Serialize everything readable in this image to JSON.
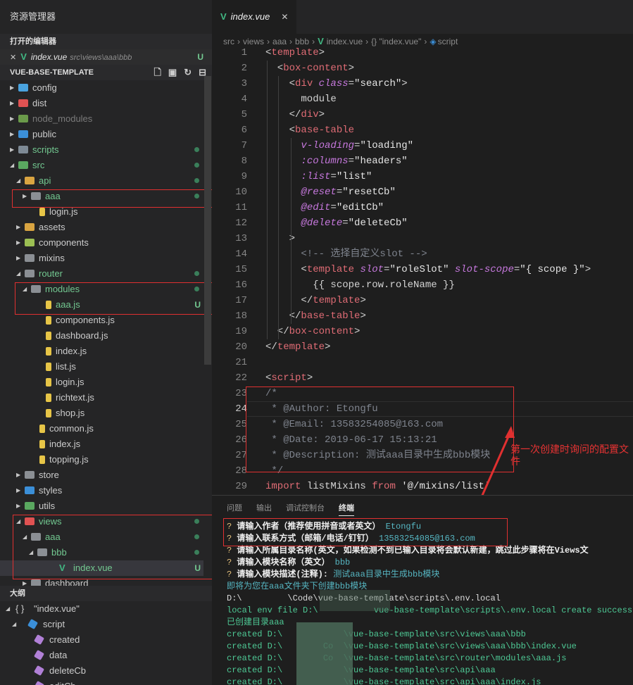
{
  "sidebar": {
    "title": "资源管理器",
    "open_editors": {
      "header": "打开的编辑器",
      "items": [
        {
          "close": "✕",
          "name": "index.vue",
          "path": "src\\views\\aaa\\bbb",
          "status": "U"
        }
      ]
    },
    "project": {
      "header": "VUE-BASE-TEMPLATE",
      "tools": [
        "new-file-icon",
        "new-folder-icon",
        "refresh-icon",
        "collapse-all-icon"
      ]
    },
    "tree": [
      {
        "label": "config",
        "depth": 0,
        "expanded": false,
        "icon": "#4aa3df"
      },
      {
        "label": "dist",
        "depth": 0,
        "expanded": false,
        "icon": "#e05252"
      },
      {
        "label": "node_modules",
        "depth": 0,
        "expanded": false,
        "icon": "#6a9a4a",
        "dim": true
      },
      {
        "label": "public",
        "depth": 0,
        "expanded": false,
        "icon": "#3b8fd8"
      },
      {
        "label": "scripts",
        "depth": 0,
        "expanded": false,
        "icon": "#7e8a95",
        "dot": true
      },
      {
        "label": "src",
        "depth": 0,
        "expanded": true,
        "icon": "#5aa860",
        "dot": true
      },
      {
        "label": "api",
        "depth": 1,
        "expanded": true,
        "icon": "#d9a441",
        "dot": true
      },
      {
        "label": "aaa",
        "depth": 2,
        "expanded": false,
        "icon": "#8b8f94",
        "dot": true
      },
      {
        "label": "login.js",
        "depth": 2,
        "file": true,
        "icon": "#e7c547"
      },
      {
        "label": "assets",
        "depth": 1,
        "expanded": false,
        "icon": "#d9a441"
      },
      {
        "label": "components",
        "depth": 1,
        "expanded": false,
        "icon": "#9bbf53"
      },
      {
        "label": "mixins",
        "depth": 1,
        "expanded": false,
        "icon": "#8b8f94"
      },
      {
        "label": "router",
        "depth": 1,
        "expanded": true,
        "icon": "#8b8f94",
        "dot": true
      },
      {
        "label": "modules",
        "depth": 2,
        "expanded": true,
        "icon": "#8b8f94",
        "dot": true
      },
      {
        "label": "aaa.js",
        "depth": 3,
        "file": true,
        "icon": "#e7c547",
        "status": "U"
      },
      {
        "label": "components.js",
        "depth": 3,
        "file": true,
        "icon": "#e7c547"
      },
      {
        "label": "dashboard.js",
        "depth": 3,
        "file": true,
        "icon": "#e7c547"
      },
      {
        "label": "index.js",
        "depth": 3,
        "file": true,
        "icon": "#e7c547"
      },
      {
        "label": "list.js",
        "depth": 3,
        "file": true,
        "icon": "#e7c547"
      },
      {
        "label": "login.js",
        "depth": 3,
        "file": true,
        "icon": "#e7c547"
      },
      {
        "label": "richtext.js",
        "depth": 3,
        "file": true,
        "icon": "#e7c547"
      },
      {
        "label": "shop.js",
        "depth": 3,
        "file": true,
        "icon": "#e7c547"
      },
      {
        "label": "common.js",
        "depth": 2,
        "file": true,
        "icon": "#e7c547"
      },
      {
        "label": "index.js",
        "depth": 2,
        "file": true,
        "icon": "#e7c547"
      },
      {
        "label": "topping.js",
        "depth": 2,
        "file": true,
        "icon": "#e7c547"
      },
      {
        "label": "store",
        "depth": 1,
        "expanded": false,
        "icon": "#8b8f94"
      },
      {
        "label": "styles",
        "depth": 1,
        "expanded": false,
        "icon": "#3b8fd8"
      },
      {
        "label": "utils",
        "depth": 1,
        "expanded": false,
        "icon": "#5aa860"
      },
      {
        "label": "views",
        "depth": 1,
        "expanded": true,
        "icon": "#e05252",
        "dot": true
      },
      {
        "label": "aaa",
        "depth": 2,
        "expanded": true,
        "icon": "#8b8f94",
        "dot": true
      },
      {
        "label": "bbb",
        "depth": 3,
        "expanded": true,
        "icon": "#8b8f94",
        "dot": true
      },
      {
        "label": "index.vue",
        "depth": 4,
        "file": true,
        "vue": true,
        "status": "U",
        "selected": true
      },
      {
        "label": "dashboard",
        "depth": 2,
        "expanded": false,
        "icon": "#8b8f94"
      }
    ],
    "outline": {
      "header": "大纲",
      "items": [
        {
          "label": "\"index.vue\"",
          "prefix": "{ }",
          "depth": 0,
          "expanded": true
        },
        {
          "label": "script",
          "depth": 1,
          "expanded": true,
          "icon": "#3b8fd8"
        },
        {
          "label": "created",
          "depth": 2,
          "icon": "#b180d7"
        },
        {
          "label": "data",
          "depth": 2,
          "icon": "#b180d7"
        },
        {
          "label": "deleteCb",
          "depth": 2,
          "icon": "#b180d7"
        },
        {
          "label": "editCb",
          "depth": 2,
          "icon": "#b180d7"
        }
      ]
    }
  },
  "editor": {
    "tab": {
      "name": "index.vue",
      "close": "✕"
    },
    "breadcrumbs": [
      "src",
      "views",
      "aaa",
      "bbb",
      "index.vue",
      "{} \"index.vue\"",
      "script"
    ],
    "code": [
      [
        {
          "t": "<",
          "c": "br"
        },
        {
          "t": "template",
          "c": "tg"
        },
        {
          "t": ">",
          "c": "br"
        }
      ],
      [
        {
          "t": "  <",
          "c": "br"
        },
        {
          "t": "box-content",
          "c": "tg"
        },
        {
          "t": ">",
          "c": "br"
        }
      ],
      [
        {
          "t": "    <",
          "c": "br"
        },
        {
          "t": "div ",
          "c": "tg"
        },
        {
          "t": "class",
          "c": "at"
        },
        {
          "t": "=",
          "c": "br"
        },
        {
          "t": "\"search\"",
          "c": "st"
        },
        {
          "t": ">",
          "c": "br"
        }
      ],
      [
        {
          "t": "      module",
          "c": "br"
        }
      ],
      [
        {
          "t": "    </",
          "c": "br"
        },
        {
          "t": "div",
          "c": "tg"
        },
        {
          "t": ">",
          "c": "br"
        }
      ],
      [
        {
          "t": "    <",
          "c": "br"
        },
        {
          "t": "base-table",
          "c": "tg"
        }
      ],
      [
        {
          "t": "      ",
          "c": "br"
        },
        {
          "t": "v-loading",
          "c": "at"
        },
        {
          "t": "=",
          "c": "br"
        },
        {
          "t": "\"loading\"",
          "c": "st"
        }
      ],
      [
        {
          "t": "      ",
          "c": "br"
        },
        {
          "t": ":columns",
          "c": "at"
        },
        {
          "t": "=",
          "c": "br"
        },
        {
          "t": "\"headers\"",
          "c": "st"
        }
      ],
      [
        {
          "t": "      ",
          "c": "br"
        },
        {
          "t": ":list",
          "c": "at"
        },
        {
          "t": "=",
          "c": "br"
        },
        {
          "t": "\"list\"",
          "c": "st"
        }
      ],
      [
        {
          "t": "      ",
          "c": "br"
        },
        {
          "t": "@reset",
          "c": "at"
        },
        {
          "t": "=",
          "c": "br"
        },
        {
          "t": "\"resetCb\"",
          "c": "st"
        }
      ],
      [
        {
          "t": "      ",
          "c": "br"
        },
        {
          "t": "@edit",
          "c": "at"
        },
        {
          "t": "=",
          "c": "br"
        },
        {
          "t": "\"editCb\"",
          "c": "st"
        }
      ],
      [
        {
          "t": "      ",
          "c": "br"
        },
        {
          "t": "@delete",
          "c": "at"
        },
        {
          "t": "=",
          "c": "br"
        },
        {
          "t": "\"deleteCb\"",
          "c": "st"
        }
      ],
      [
        {
          "t": "    >",
          "c": "br"
        }
      ],
      [
        {
          "t": "      <!-- 选择自定义slot -->",
          "c": "cm"
        }
      ],
      [
        {
          "t": "      <",
          "c": "br"
        },
        {
          "t": "template ",
          "c": "tg"
        },
        {
          "t": "slot",
          "c": "at"
        },
        {
          "t": "=",
          "c": "br"
        },
        {
          "t": "\"roleSlot\" ",
          "c": "st"
        },
        {
          "t": "slot-scope",
          "c": "at"
        },
        {
          "t": "=",
          "c": "br"
        },
        {
          "t": "\"{ scope }\"",
          "c": "st"
        },
        {
          "t": ">",
          "c": "br"
        }
      ],
      [
        {
          "t": "        {{ scope.row.roleName }}",
          "c": "br"
        }
      ],
      [
        {
          "t": "      </",
          "c": "br"
        },
        {
          "t": "template",
          "c": "tg"
        },
        {
          "t": ">",
          "c": "br"
        }
      ],
      [
        {
          "t": "    </",
          "c": "br"
        },
        {
          "t": "base-table",
          "c": "tg"
        },
        {
          "t": ">",
          "c": "br"
        }
      ],
      [
        {
          "t": "  </",
          "c": "br"
        },
        {
          "t": "box-content",
          "c": "tg"
        },
        {
          "t": ">",
          "c": "br"
        }
      ],
      [
        {
          "t": "</",
          "c": "br"
        },
        {
          "t": "template",
          "c": "tg"
        },
        {
          "t": ">",
          "c": "br"
        }
      ],
      [
        {
          "t": "",
          "c": "br"
        }
      ],
      [
        {
          "t": "<",
          "c": "br"
        },
        {
          "t": "script",
          "c": "tg"
        },
        {
          "t": ">",
          "c": "br"
        }
      ],
      [
        {
          "t": "/*",
          "c": "cm"
        }
      ],
      [
        {
          "t": " * @Author: Etongfu",
          "c": "cm"
        }
      ],
      [
        {
          "t": " * @Email: 13583254085@163.com",
          "c": "cm"
        }
      ],
      [
        {
          "t": " * @Date: 2019-06-17 15:13:21",
          "c": "cm"
        }
      ],
      [
        {
          "t": " * @Description: 测试aaa目录中生成bbb模块",
          "c": "cm"
        }
      ],
      [
        {
          "t": " */",
          "c": "cm"
        }
      ],
      [
        {
          "t": "import ",
          "c": "kw"
        },
        {
          "t": "listMixins ",
          "c": "br"
        },
        {
          "t": "from ",
          "c": "kw"
        },
        {
          "t": "'@/mixins/list'",
          "c": "st"
        }
      ]
    ],
    "annotation": "第一次创建时询问的配置文件"
  },
  "panel": {
    "tabs": [
      "问题",
      "输出",
      "调试控制台",
      "终端"
    ],
    "active_tab": "终端",
    "terminal": [
      [
        {
          "t": "? ",
          "c": "q"
        },
        {
          "t": "请输入作者（推荐使用拼音或者英文）",
          "c": "qb"
        },
        {
          "t": " Etongfu",
          "c": "ans"
        }
      ],
      [
        {
          "t": "? ",
          "c": "q"
        },
        {
          "t": "请输入联系方式（邮箱/电话/钉钉）",
          "c": "qb"
        },
        {
          "t": " 13583254085@163.com",
          "c": "ans"
        }
      ],
      [
        {
          "t": "? ",
          "c": "q"
        },
        {
          "t": "请输入所属目录名称(英文，如果检测不到已输入目录将会默认新建，跳过此步骤将在Views文",
          "c": "qb"
        }
      ],
      [
        {
          "t": "? ",
          "c": "q"
        },
        {
          "t": "请输入模块名称（英文）",
          "c": "qb"
        },
        {
          "t": " bbb",
          "c": "ans"
        }
      ],
      [
        {
          "t": "? ",
          "c": "q"
        },
        {
          "t": "请输入模块描述(注释):",
          "c": "qb"
        },
        {
          "t": " 测试aaa目录中生成bbb模块",
          "c": "ans"
        }
      ],
      [
        {
          "t": "即将为您在aaa文件夹下创建bbb模块",
          "c": "ans"
        }
      ],
      [
        {
          "t": "D:\\         \\Code\\vue-base-template\\scripts\\.env.local",
          "c": "wt"
        }
      ],
      [
        {
          "t": "local env file D:\\           vue-base-template\\scripts\\.env.local create success",
          "c": "ok"
        }
      ],
      [
        {
          "t": "已创建目录aaa",
          "c": "ok"
        }
      ],
      [
        {
          "t": "created D:\\            \\vue-base-template\\src\\views\\aaa\\bbb",
          "c": "ok"
        }
      ],
      [
        {
          "t": "created D:\\        Co  \\vue-base-template\\src\\views\\aaa\\bbb\\index.vue",
          "c": "ok"
        }
      ],
      [
        {
          "t": "created D:\\        Co  \\vue-base-template\\src\\router\\modules\\aaa.js",
          "c": "ok"
        }
      ],
      [
        {
          "t": "created D:\\            \\vue-base-template\\src\\api\\aaa",
          "c": "ok"
        }
      ],
      [
        {
          "t": "created D:\\            \\vue-base-template\\src\\api\\aaa\\index.js",
          "c": "ok"
        }
      ]
    ]
  }
}
